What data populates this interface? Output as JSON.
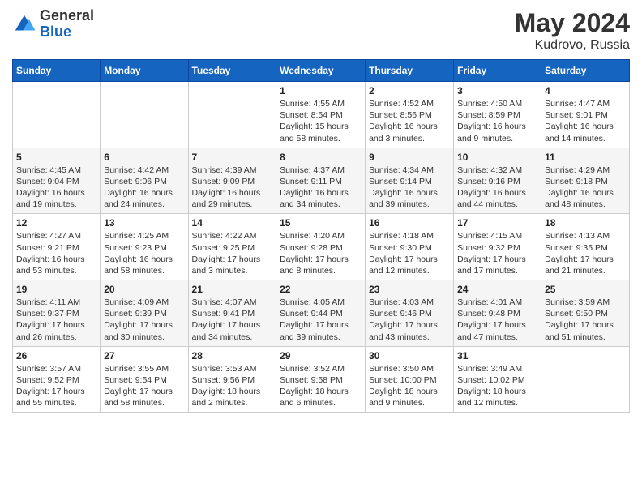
{
  "logo": {
    "general": "General",
    "blue": "Blue"
  },
  "title": {
    "month_year": "May 2024",
    "location": "Kudrovo, Russia"
  },
  "weekdays": [
    "Sunday",
    "Monday",
    "Tuesday",
    "Wednesday",
    "Thursday",
    "Friday",
    "Saturday"
  ],
  "weeks": [
    [
      {
        "day": "",
        "info": ""
      },
      {
        "day": "",
        "info": ""
      },
      {
        "day": "",
        "info": ""
      },
      {
        "day": "1",
        "info": "Sunrise: 4:55 AM\nSunset: 8:54 PM\nDaylight: 15 hours\nand 58 minutes."
      },
      {
        "day": "2",
        "info": "Sunrise: 4:52 AM\nSunset: 8:56 PM\nDaylight: 16 hours\nand 3 minutes."
      },
      {
        "day": "3",
        "info": "Sunrise: 4:50 AM\nSunset: 8:59 PM\nDaylight: 16 hours\nand 9 minutes."
      },
      {
        "day": "4",
        "info": "Sunrise: 4:47 AM\nSunset: 9:01 PM\nDaylight: 16 hours\nand 14 minutes."
      }
    ],
    [
      {
        "day": "5",
        "info": "Sunrise: 4:45 AM\nSunset: 9:04 PM\nDaylight: 16 hours\nand 19 minutes."
      },
      {
        "day": "6",
        "info": "Sunrise: 4:42 AM\nSunset: 9:06 PM\nDaylight: 16 hours\nand 24 minutes."
      },
      {
        "day": "7",
        "info": "Sunrise: 4:39 AM\nSunset: 9:09 PM\nDaylight: 16 hours\nand 29 minutes."
      },
      {
        "day": "8",
        "info": "Sunrise: 4:37 AM\nSunset: 9:11 PM\nDaylight: 16 hours\nand 34 minutes."
      },
      {
        "day": "9",
        "info": "Sunrise: 4:34 AM\nSunset: 9:14 PM\nDaylight: 16 hours\nand 39 minutes."
      },
      {
        "day": "10",
        "info": "Sunrise: 4:32 AM\nSunset: 9:16 PM\nDaylight: 16 hours\nand 44 minutes."
      },
      {
        "day": "11",
        "info": "Sunrise: 4:29 AM\nSunset: 9:18 PM\nDaylight: 16 hours\nand 48 minutes."
      }
    ],
    [
      {
        "day": "12",
        "info": "Sunrise: 4:27 AM\nSunset: 9:21 PM\nDaylight: 16 hours\nand 53 minutes."
      },
      {
        "day": "13",
        "info": "Sunrise: 4:25 AM\nSunset: 9:23 PM\nDaylight: 16 hours\nand 58 minutes."
      },
      {
        "day": "14",
        "info": "Sunrise: 4:22 AM\nSunset: 9:25 PM\nDaylight: 17 hours\nand 3 minutes."
      },
      {
        "day": "15",
        "info": "Sunrise: 4:20 AM\nSunset: 9:28 PM\nDaylight: 17 hours\nand 8 minutes."
      },
      {
        "day": "16",
        "info": "Sunrise: 4:18 AM\nSunset: 9:30 PM\nDaylight: 17 hours\nand 12 minutes."
      },
      {
        "day": "17",
        "info": "Sunrise: 4:15 AM\nSunset: 9:32 PM\nDaylight: 17 hours\nand 17 minutes."
      },
      {
        "day": "18",
        "info": "Sunrise: 4:13 AM\nSunset: 9:35 PM\nDaylight: 17 hours\nand 21 minutes."
      }
    ],
    [
      {
        "day": "19",
        "info": "Sunrise: 4:11 AM\nSunset: 9:37 PM\nDaylight: 17 hours\nand 26 minutes."
      },
      {
        "day": "20",
        "info": "Sunrise: 4:09 AM\nSunset: 9:39 PM\nDaylight: 17 hours\nand 30 minutes."
      },
      {
        "day": "21",
        "info": "Sunrise: 4:07 AM\nSunset: 9:41 PM\nDaylight: 17 hours\nand 34 minutes."
      },
      {
        "day": "22",
        "info": "Sunrise: 4:05 AM\nSunset: 9:44 PM\nDaylight: 17 hours\nand 39 minutes."
      },
      {
        "day": "23",
        "info": "Sunrise: 4:03 AM\nSunset: 9:46 PM\nDaylight: 17 hours\nand 43 minutes."
      },
      {
        "day": "24",
        "info": "Sunrise: 4:01 AM\nSunset: 9:48 PM\nDaylight: 17 hours\nand 47 minutes."
      },
      {
        "day": "25",
        "info": "Sunrise: 3:59 AM\nSunset: 9:50 PM\nDaylight: 17 hours\nand 51 minutes."
      }
    ],
    [
      {
        "day": "26",
        "info": "Sunrise: 3:57 AM\nSunset: 9:52 PM\nDaylight: 17 hours\nand 55 minutes."
      },
      {
        "day": "27",
        "info": "Sunrise: 3:55 AM\nSunset: 9:54 PM\nDaylight: 17 hours\nand 58 minutes."
      },
      {
        "day": "28",
        "info": "Sunrise: 3:53 AM\nSunset: 9:56 PM\nDaylight: 18 hours\nand 2 minutes."
      },
      {
        "day": "29",
        "info": "Sunrise: 3:52 AM\nSunset: 9:58 PM\nDaylight: 18 hours\nand 6 minutes."
      },
      {
        "day": "30",
        "info": "Sunrise: 3:50 AM\nSunset: 10:00 PM\nDaylight: 18 hours\nand 9 minutes."
      },
      {
        "day": "31",
        "info": "Sunrise: 3:49 AM\nSunset: 10:02 PM\nDaylight: 18 hours\nand 12 minutes."
      },
      {
        "day": "",
        "info": ""
      }
    ]
  ]
}
